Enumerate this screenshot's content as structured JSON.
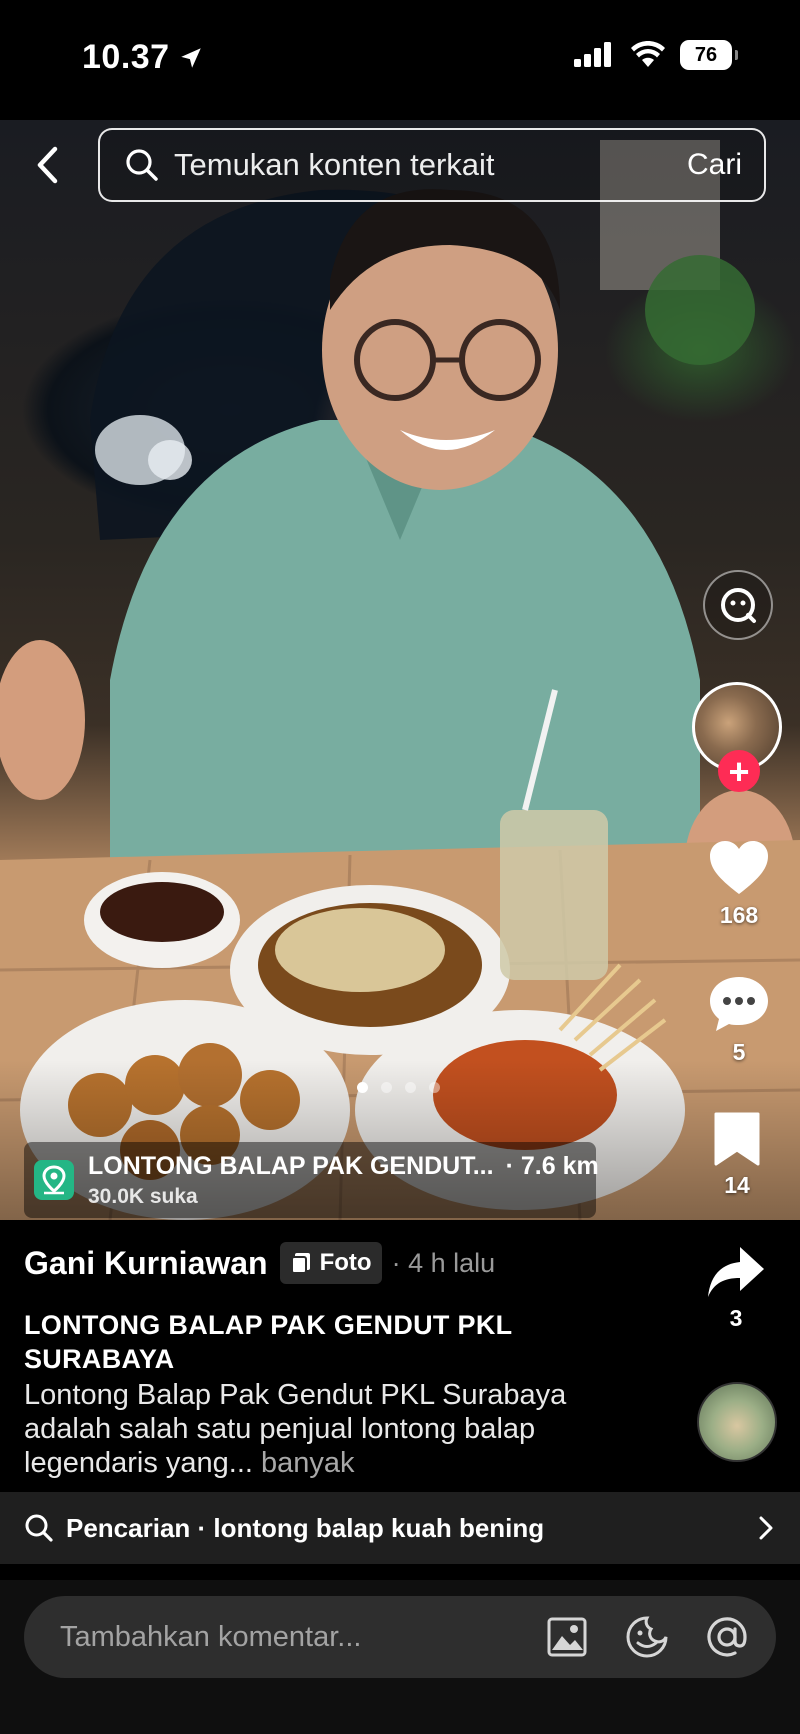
{
  "status_bar": {
    "time": "10.37",
    "battery": "76",
    "icons": [
      "location-arrow-icon",
      "cellular-signal-icon",
      "wifi-icon",
      "battery-icon"
    ]
  },
  "search": {
    "placeholder": "Temukan konten terkait",
    "action": "Cari"
  },
  "rail": {
    "likes": "168",
    "comments": "5",
    "saves": "14",
    "shares": "3"
  },
  "carousel": {
    "total": 4,
    "active": 1
  },
  "location": {
    "name": "LONTONG BALAP PAK GENDUT...",
    "distance": "· 7.6 km",
    "likes": "30.0K suka"
  },
  "post": {
    "author": "Gani Kurniawan",
    "type": "Foto",
    "time": "· 4 h lalu",
    "title": "LONTONG BALAP PAK GENDUT PKL SURABAYA",
    "description": "Lontong Balap Pak Gendut PKL Surabaya adalah salah satu penjual lontong balap legendaris yang...",
    "more": " banyak"
  },
  "related_search": {
    "text": "Pencarian · lontong balap kuah bening"
  },
  "comment": {
    "placeholder": "Tambahkan komentar..."
  },
  "colors": {
    "accent": "#fe2c55",
    "location_icon": "#24b685",
    "background": "#000000"
  }
}
